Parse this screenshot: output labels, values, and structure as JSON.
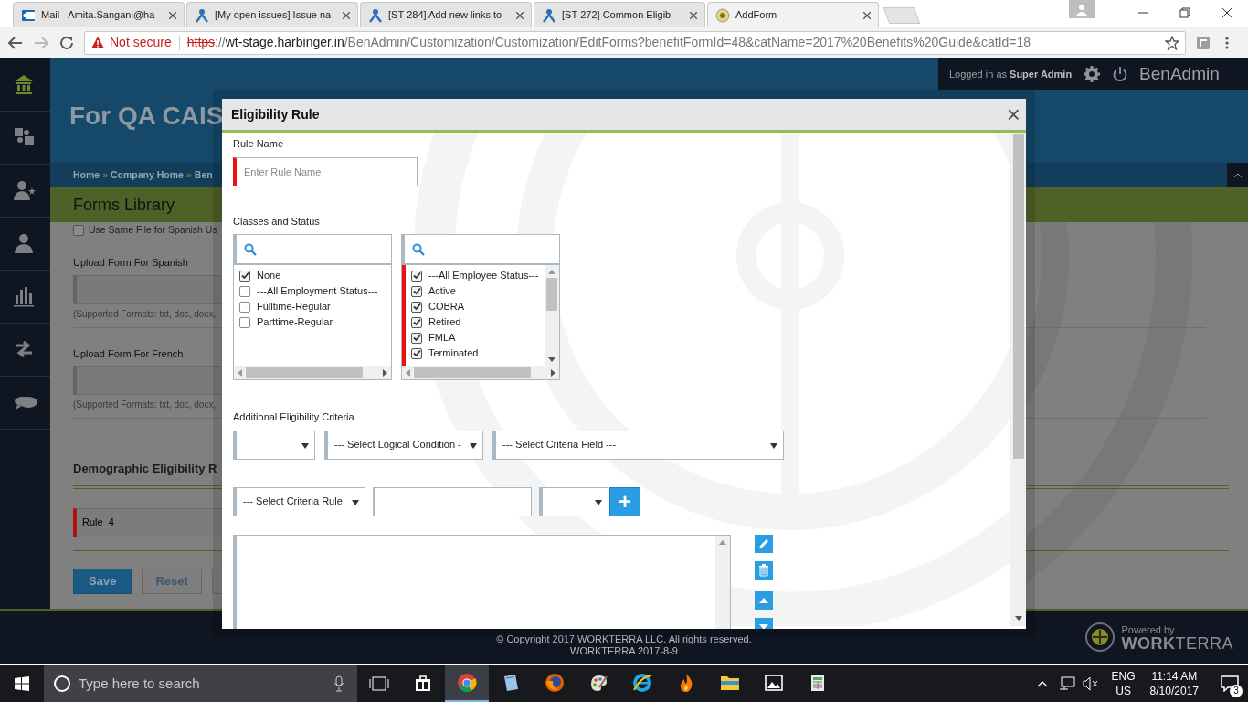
{
  "browser": {
    "tabs": [
      {
        "title": "Mail - Amita.Sangani@ha",
        "selected": false
      },
      {
        "title": "[My open issues] Issue na",
        "selected": false
      },
      {
        "title": "[ST-284] Add new links to",
        "selected": false
      },
      {
        "title": "[ST-272] Common Eligib",
        "selected": false
      },
      {
        "title": "AddForm",
        "selected": true
      }
    ],
    "address": {
      "security": "Not secure",
      "scheme": "https",
      "separator": "://",
      "host": "wt-stage.harbinger.in",
      "path": "/BenAdmin/Customization/Customization/EditForms?benefitFormId=48&catName=2017%20Benefits%20Guide&catId=18"
    }
  },
  "app": {
    "session": {
      "prefix": "Logged in as",
      "user": "Super Admin",
      "brand": "BenAdmin"
    },
    "sidebar": [
      {
        "kind": "home",
        "selected": true
      },
      {
        "kind": "puzzle",
        "selected": false
      },
      {
        "kind": "user-star",
        "selected": false
      },
      {
        "kind": "user",
        "selected": false
      },
      {
        "kind": "chart",
        "selected": false
      },
      {
        "kind": "arrows",
        "selected": false
      },
      {
        "kind": "chat",
        "selected": false
      }
    ],
    "title": "For QA CAIS",
    "breadcrumbs": [
      "Home",
      "Company Home",
      "Ben"
    ],
    "breadcrumb_separator": "»",
    "section": "Forms Library",
    "same_file": {
      "label": "Use Same File for Spanish Us",
      "checked": false
    },
    "uploads": [
      {
        "label": "Upload Form For Spanish",
        "hint": "(Supported Formats: txt, doc, docx,"
      },
      {
        "label": "Upload Form For French",
        "hint": "(Supported Formats: txt, doc, docx,"
      }
    ],
    "rules_heading": "Demographic Eligibility R",
    "rule": {
      "value": "Rule_4",
      "required": true
    },
    "buttons": [
      {
        "label": "Save",
        "kind": "primary"
      },
      {
        "label": "Reset",
        "kind": "secondary"
      },
      {
        "kind": "secondary"
      }
    ],
    "footer": {
      "copyright": "© Copyright 2017 WORKTERRA LLC. All rights reserved.",
      "version": "WORKTERRA 2017-8-9",
      "powered_by": "Powered by",
      "brand_bold": "WORK",
      "brand_light": "TERRA"
    }
  },
  "dialog": {
    "title": "Eligibility Rule",
    "close": "×",
    "rule_name": {
      "label": "Rule Name",
      "placeholder": "Enter Rule Name",
      "required": true
    },
    "classes_label": "Classes and Status",
    "lists": [
      {
        "required": false,
        "items": [
          {
            "label": "None",
            "checked": true
          },
          {
            "label": "---All Employment Status---",
            "checked": false
          },
          {
            "label": "Fulltime-Regular",
            "checked": false
          },
          {
            "label": "Parttime-Regular",
            "checked": false
          }
        ]
      },
      {
        "required": true,
        "items": [
          {
            "label": "---All Employee Status---",
            "checked": true
          },
          {
            "label": "Active",
            "checked": true
          },
          {
            "label": "COBRA",
            "checked": true
          },
          {
            "label": "Retired",
            "checked": true
          },
          {
            "label": "FMLA",
            "checked": true
          },
          {
            "label": "Terminated",
            "checked": true
          }
        ]
      }
    ],
    "criteria_label": "Additional Eligibility Criteria",
    "criteria_rows": [
      [
        {
          "kind": "select"
        },
        {
          "kind": "select",
          "value": "--- Select Logical Condition -"
        },
        {
          "kind": "select",
          "value": "--- Select Criteria Field ---"
        }
      ],
      [
        {
          "kind": "select",
          "value": "--- Select Criteria Rule"
        },
        {
          "kind": "input"
        },
        {
          "kind": "select"
        },
        {
          "kind": "add",
          "label": "+"
        }
      ]
    ]
  },
  "taskbar": {
    "search_placeholder": "Type here to search",
    "apps": [
      {
        "kind": "store",
        "selected": false
      },
      {
        "kind": "chrome",
        "selected": true
      },
      {
        "kind": "notes",
        "selected": false
      },
      {
        "kind": "firefox",
        "selected": false
      },
      {
        "kind": "paint",
        "selected": false
      },
      {
        "kind": "ie",
        "selected": false
      },
      {
        "kind": "flame",
        "selected": false
      },
      {
        "kind": "folder",
        "selected": false
      },
      {
        "kind": "photos",
        "selected": false
      },
      {
        "kind": "sheet",
        "selected": false
      }
    ],
    "language": "ENG",
    "region": "US",
    "time": "11:14 AM",
    "date": "8/10/2017",
    "notifications": "3"
  }
}
